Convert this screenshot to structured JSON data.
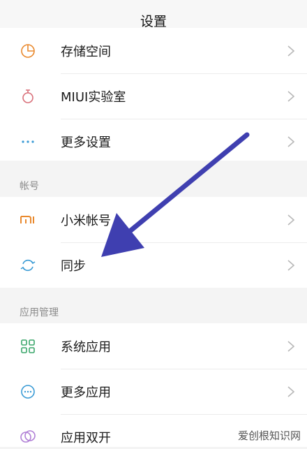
{
  "header": {
    "title": "设置"
  },
  "group1": {
    "items": [
      {
        "label": "存储空间",
        "icon": "storage-pie-icon"
      },
      {
        "label": "MIUI实验室",
        "icon": "lab-flask-icon"
      },
      {
        "label": "更多设置",
        "icon": "more-dots-icon"
      }
    ]
  },
  "account_section": {
    "title": "帐号",
    "items": [
      {
        "label": "小米帐号",
        "icon": "mi-logo-icon"
      },
      {
        "label": "同步",
        "icon": "sync-icon"
      }
    ]
  },
  "apps_section": {
    "title": "应用管理",
    "items": [
      {
        "label": "系统应用",
        "icon": "grid-apps-icon"
      },
      {
        "label": "更多应用",
        "icon": "more-apps-icon"
      },
      {
        "label": "应用双开",
        "icon": "dual-apps-icon"
      }
    ]
  },
  "watermark": {
    "text": "爱创根知识网"
  },
  "colors": {
    "arrow": "#3f3fb0",
    "mi_orange": "#e9892d",
    "sync_blue": "#3a9bd5",
    "grid_green": "#3aa66a"
  }
}
